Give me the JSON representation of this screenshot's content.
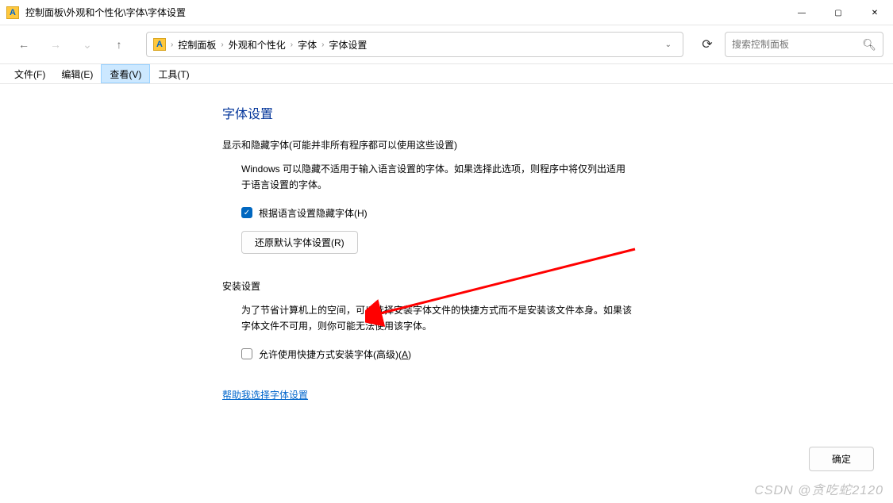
{
  "titlebar": {
    "title": "控制面板\\外观和个性化\\字体\\字体设置",
    "icon_letter": "A"
  },
  "window_controls": {
    "minimize": "—",
    "maximize": "▢",
    "close": "✕"
  },
  "nav": {
    "back": "←",
    "forward": "→",
    "up": "↑",
    "dropdown": "⌄",
    "refresh": "⟳"
  },
  "breadcrumb": {
    "items": [
      "控制面板",
      "外观和个性化",
      "字体",
      "字体设置"
    ],
    "sep": "›",
    "icon_letter": "A"
  },
  "search": {
    "placeholder": "搜索控制面板",
    "icon": "🔍︎"
  },
  "menubar": {
    "file": "文件(F)",
    "edit": "编辑(E)",
    "view": "查看(V)",
    "tools": "工具(T)"
  },
  "page": {
    "title": "字体设置",
    "section1": {
      "title": "显示和隐藏字体(可能并非所有程序都可以使用这些设置)",
      "desc": "Windows 可以隐藏不适用于输入语言设置的字体。如果选择此选项，则程序中将仅列出适用于语言设置的字体。",
      "checkbox_label": "根据语言设置隐藏字体(H)",
      "checkbox_checked": true,
      "button": "还原默认字体设置(R)"
    },
    "section2": {
      "title": "安装设置",
      "desc": "为了节省计算机上的空间，可以选择安装字体文件的快捷方式而不是安装该文件本身。如果该字体文件不可用，则你可能无法使用该字体。",
      "checkbox_label_pre": "允许使用快捷方式安装字体(高级)(",
      "checkbox_label_u": "A",
      "checkbox_label_post": ")",
      "checkbox_checked": false
    },
    "help_link": "帮助我选择字体设置",
    "confirm": "确定"
  },
  "watermark": "CSDN @贪吃蛇2120"
}
